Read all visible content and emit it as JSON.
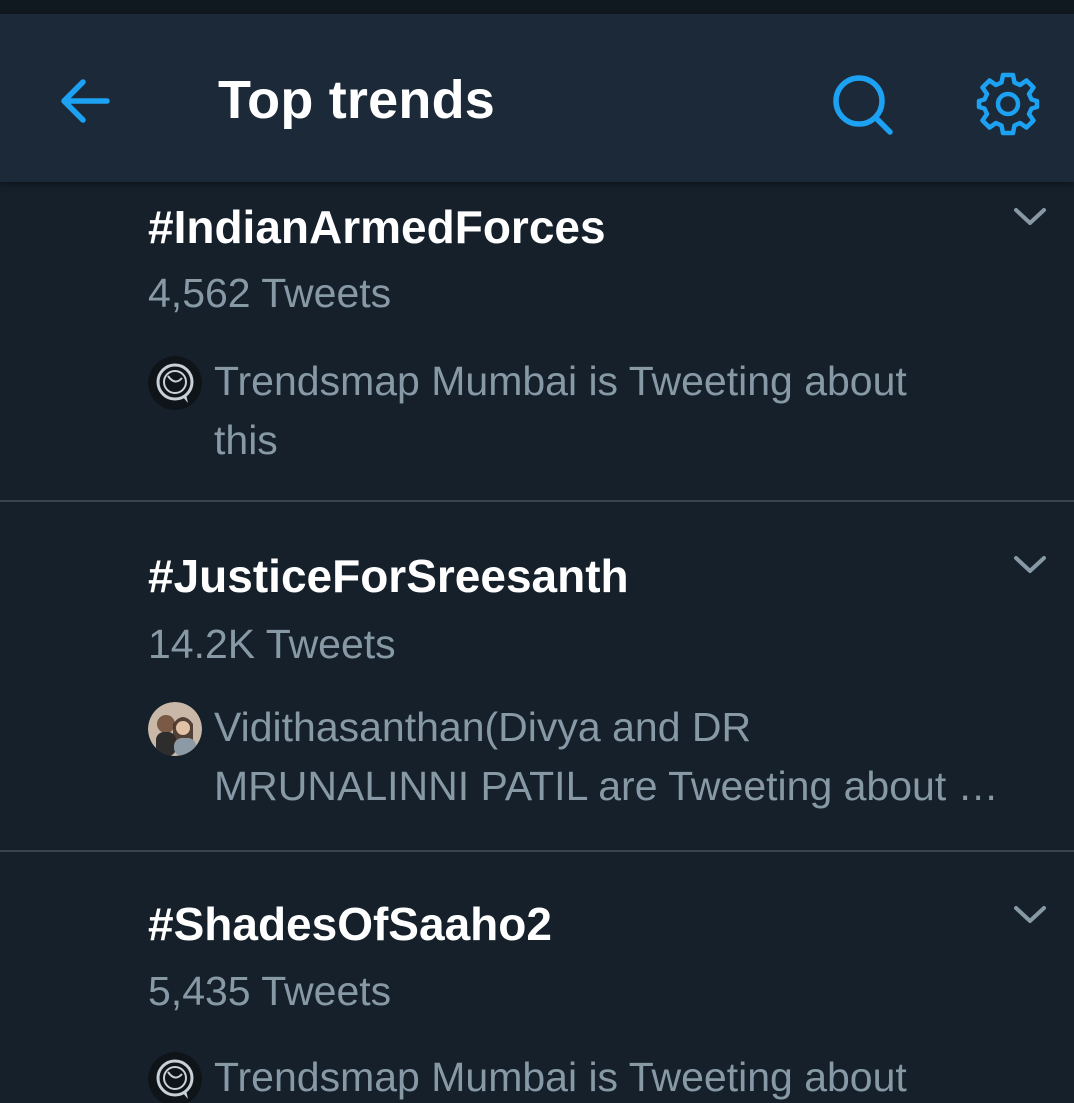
{
  "header": {
    "back_icon": "arrow-left-icon",
    "title": "Top trends",
    "search_icon": "search-icon",
    "settings_icon": "gear-icon"
  },
  "colors": {
    "background": "#15202b",
    "header_bg": "#1c2938",
    "accent": "#1da1f2",
    "primary_text": "#ffffff",
    "secondary_text": "#8899a6",
    "divider": "#38444d"
  },
  "trends": [
    {
      "name": "#IndianArmedForces",
      "count": "4,562 Tweets",
      "context_line1": "Trendsmap Mumbai is Tweeting about",
      "context_line2": "this",
      "avatar": "trendsmap-logo-icon"
    },
    {
      "name": "#JusticeForSreesanth",
      "count": "14.2K Tweets",
      "context_line1": "Vidithasanthan(Divya and DR",
      "context_line2": "MRUNALINNI PATIL are Tweeting about …",
      "avatar": "user-avatar"
    },
    {
      "name": "#ShadesOfSaaho2",
      "count": "5,435 Tweets",
      "context_line1": "Trendsmap Mumbai is Tweeting about",
      "context_line2": "",
      "avatar": "trendsmap-logo-icon"
    }
  ]
}
